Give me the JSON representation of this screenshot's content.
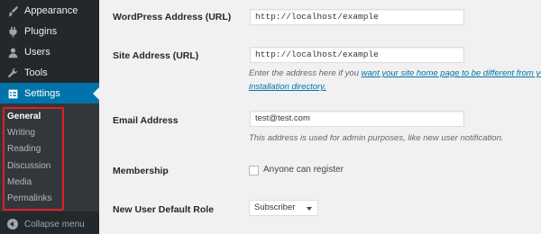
{
  "sidebar": {
    "items": [
      {
        "label": "Appearance",
        "icon": "brush-icon"
      },
      {
        "label": "Plugins",
        "icon": "plug-icon"
      },
      {
        "label": "Users",
        "icon": "users-icon"
      },
      {
        "label": "Tools",
        "icon": "wrench-icon"
      },
      {
        "label": "Settings",
        "icon": "settings-icon",
        "current": true
      }
    ],
    "submenu": [
      "General",
      "Writing",
      "Reading",
      "Discussion",
      "Media",
      "Permalinks"
    ],
    "active_submenu": "General",
    "collapse_label": "Collapse menu"
  },
  "form": {
    "wp_address": {
      "label": "WordPress Address (URL)",
      "value": "http://localhost/example"
    },
    "site_address": {
      "label": "Site Address (URL)",
      "value": "http://localhost/example",
      "desc_prefix": "Enter the address here if you ",
      "desc_link": "want your site home page to be different from you",
      "desc_link2": "installation directory."
    },
    "email": {
      "label": "Email Address",
      "value": "test@test.com",
      "desc": "This address is used for admin purposes, like new user notification."
    },
    "membership": {
      "label": "Membership",
      "checkbox_label": "Anyone can register",
      "checked": false
    },
    "default_role": {
      "label": "New User Default Role",
      "selected": "Subscriber"
    }
  },
  "colors": {
    "sidebar_bg": "#23282d",
    "accent": "#0073aa",
    "highlight": "#e02020"
  }
}
